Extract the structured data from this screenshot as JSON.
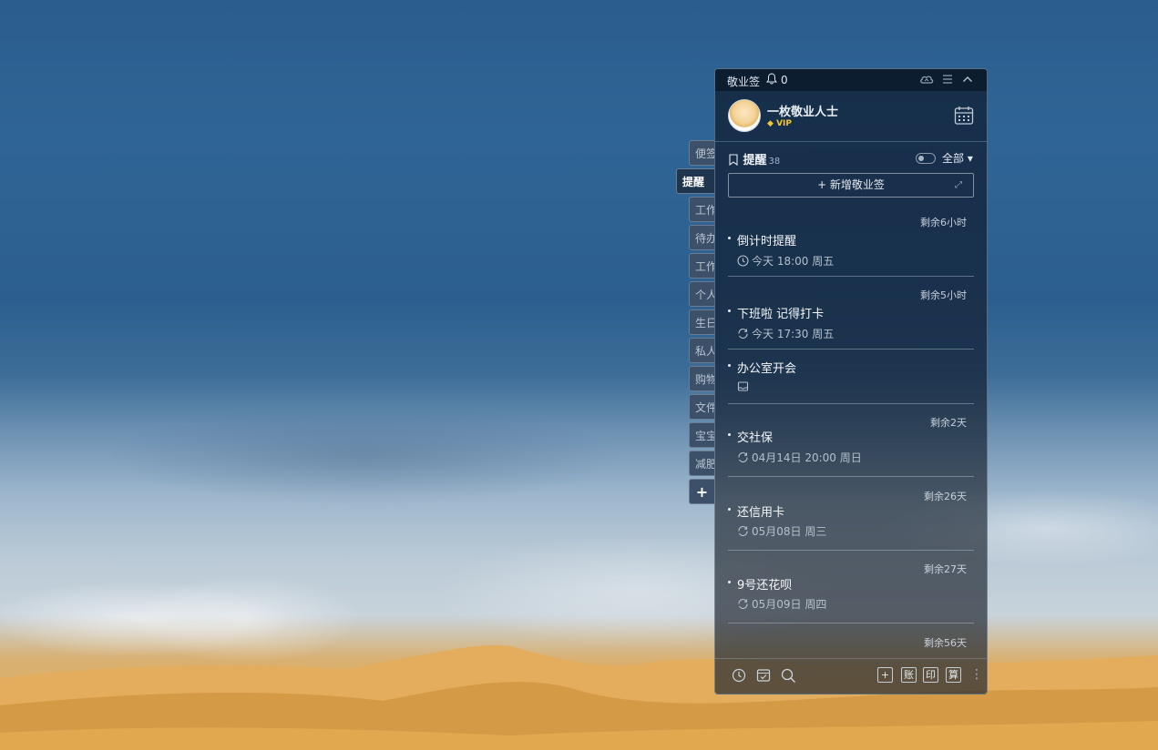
{
  "app": {
    "title": "敬业签",
    "notification_count": "0"
  },
  "user": {
    "name": "一枚敬业人士",
    "badge": "VIP"
  },
  "side_tabs": [
    {
      "label": "便签",
      "active": false
    },
    {
      "label": "提醒",
      "active": true
    },
    {
      "label": "工作",
      "active": false
    },
    {
      "label": "待办",
      "active": false
    },
    {
      "label": "工作",
      "active": false
    },
    {
      "label": "个人",
      "active": false
    },
    {
      "label": "生日",
      "active": false
    },
    {
      "label": "私人",
      "active": false
    },
    {
      "label": "购物",
      "active": false
    },
    {
      "label": "文件",
      "active": false
    },
    {
      "label": "宝宝",
      "active": false
    },
    {
      "label": "减肥",
      "active": false
    },
    {
      "label": "+",
      "active": false
    }
  ],
  "section": {
    "title": "提醒",
    "count": "38",
    "filter": "全部 ▾"
  },
  "add_button": {
    "label": "+ 新增敬业签"
  },
  "items": [
    {
      "remain": "剩余6小时",
      "title": "倒计时提醒",
      "meta": "今天 18:00 周五",
      "meta_icon": "clock-icon"
    },
    {
      "remain": "剩余5小时",
      "title": "下班啦 记得打卡",
      "meta": "今天 17:30 周五",
      "meta_icon": "repeat-icon"
    },
    {
      "remain": "",
      "title": "办公室开会",
      "meta": "",
      "meta_icon": "inbox-icon"
    },
    {
      "remain": "剩余2天",
      "title": "交社保",
      "meta": "04月14日 20:00 周日",
      "meta_icon": "repeat-icon"
    },
    {
      "remain": "剩余26天",
      "title": "还信用卡",
      "meta": "05月08日 周三",
      "meta_icon": "repeat-icon"
    },
    {
      "remain": "剩余27天",
      "title": "9号还花呗",
      "meta": "05月09日 周四",
      "meta_icon": "repeat-icon"
    },
    {
      "remain": "剩余56天",
      "title": "",
      "meta": "",
      "meta_icon": ""
    }
  ],
  "bottom_bar": {
    "add": "+",
    "account": "账",
    "print": "印",
    "calc": "算"
  },
  "colors": {
    "panel_bg": "#182c44",
    "accent_vip": "#f3c632",
    "text_primary": "#f5f7f9"
  }
}
